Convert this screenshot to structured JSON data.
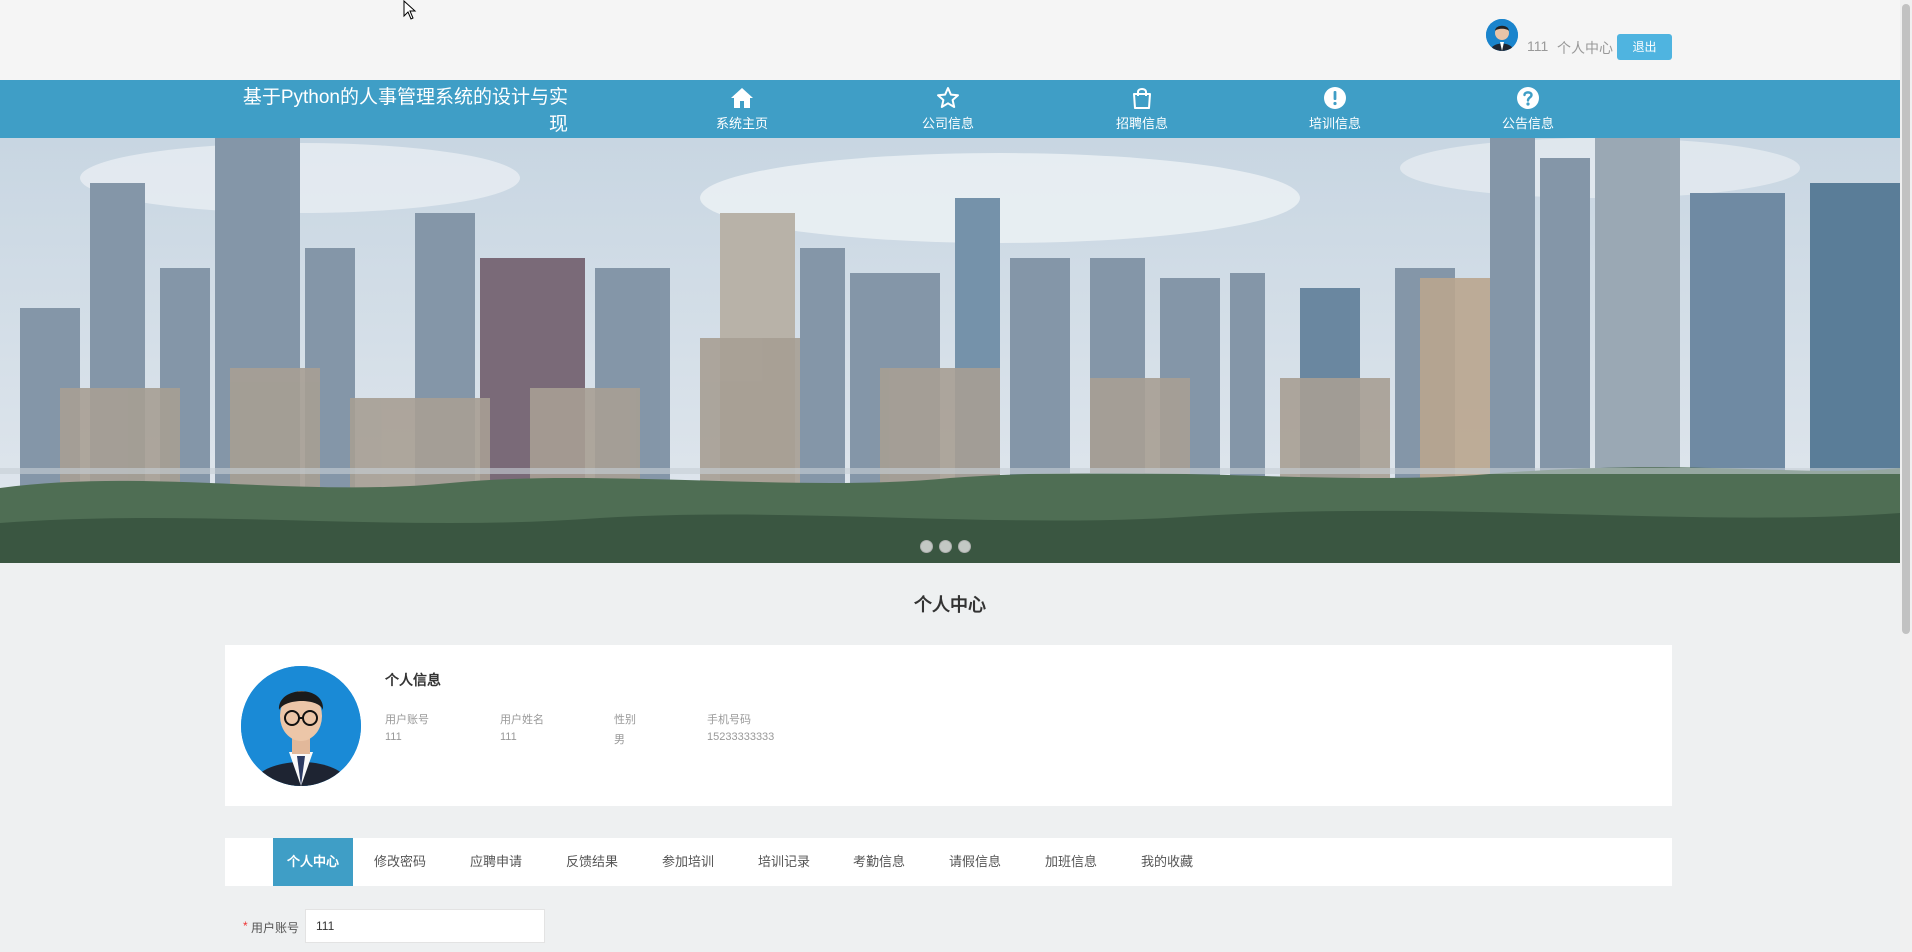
{
  "header": {
    "username": "111",
    "user_center_label": "个人中心",
    "logout_label": "退出"
  },
  "nav": {
    "brand": "基于Python的人事管理系统的设计与实现",
    "items": [
      {
        "label": "系统主页",
        "icon": "home-icon"
      },
      {
        "label": "公司信息",
        "icon": "star-icon"
      },
      {
        "label": "招聘信息",
        "icon": "shopping-bag-icon"
      },
      {
        "label": "培训信息",
        "icon": "exclamation-circle-icon"
      },
      {
        "label": "公告信息",
        "icon": "question-circle-icon"
      }
    ]
  },
  "banner": {
    "slide_count": 3,
    "active_slide": 1
  },
  "page": {
    "title": "个人中心"
  },
  "profile": {
    "card_title": "个人信息",
    "fields": [
      {
        "label": "用户账号",
        "value": "111"
      },
      {
        "label": "用户姓名",
        "value": "111"
      },
      {
        "label": "性别",
        "value": "男"
      },
      {
        "label": "手机号码",
        "value": "15233333333"
      }
    ]
  },
  "tabs": [
    {
      "label": "个人中心",
      "active": true
    },
    {
      "label": "修改密码",
      "active": false
    },
    {
      "label": "应聘申请",
      "active": false
    },
    {
      "label": "反馈结果",
      "active": false
    },
    {
      "label": "参加培训",
      "active": false
    },
    {
      "label": "培训记录",
      "active": false
    },
    {
      "label": "考勤信息",
      "active": false
    },
    {
      "label": "请假信息",
      "active": false
    },
    {
      "label": "加班信息",
      "active": false
    },
    {
      "label": "我的收藏",
      "active": false
    }
  ],
  "form": {
    "account_label": "用户账号",
    "account_required_mark": "*",
    "account_value": "111"
  },
  "colors": {
    "nav_bg": "#3f9ec6",
    "logout_bg": "#4fb4e0",
    "page_bg": "#eef0f1"
  }
}
